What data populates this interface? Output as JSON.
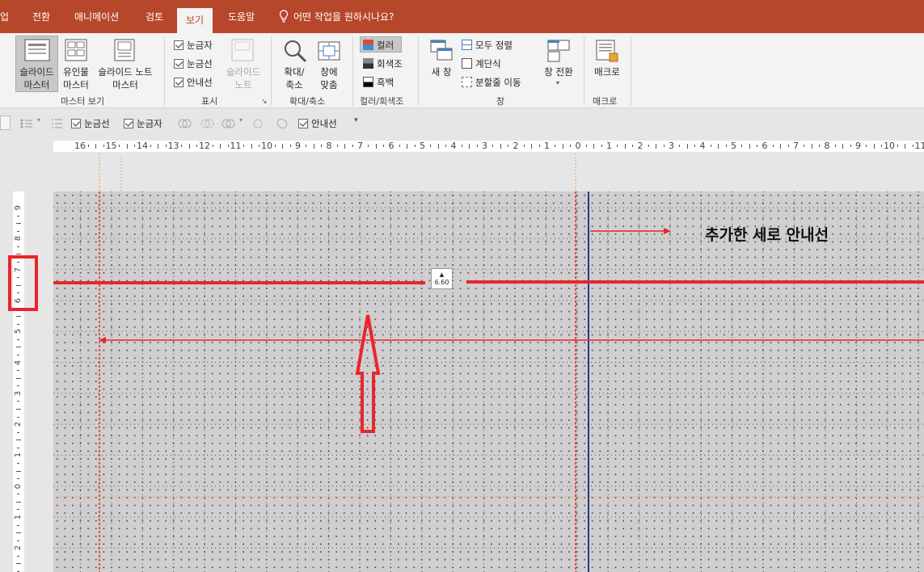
{
  "tabs": [
    {
      "label": "업",
      "active": false
    },
    {
      "label": "전환",
      "active": false
    },
    {
      "label": "애니메이션",
      "active": false
    },
    {
      "label": "검토",
      "active": false
    },
    {
      "label": "보기",
      "active": true
    },
    {
      "label": "도움말",
      "active": false
    }
  ],
  "tell_me": "어떤 작업을 원하시나요?",
  "ribbon": {
    "master_view": {
      "slide_master": [
        "슬라이드",
        "마스터"
      ],
      "handout_master": [
        "유인물",
        "마스터"
      ],
      "notes_master": [
        "슬라이드 노트",
        "마스터"
      ],
      "group": "마스터 보기"
    },
    "show": {
      "ruler": "눈금자",
      "gridlines": "눈금선",
      "guides": "안내선",
      "notes": [
        "슬라이드",
        "노트"
      ],
      "group": "표시"
    },
    "zoom": {
      "zoom": [
        "확대/",
        "축소"
      ],
      "fit_window": [
        "창에",
        "맞춤"
      ],
      "group": "확대/축소"
    },
    "color": {
      "color": "컬러",
      "grayscale": "회색조",
      "bw": "흑백",
      "group": "컬러/회색조"
    },
    "window": {
      "new_window": "새 창",
      "arrange_all": "모두 정렬",
      "cascade": "계단식",
      "move_split": "분할줄 이동",
      "switch_windows": "창 전환",
      "group": "창"
    },
    "macros": {
      "macro": "매크로",
      "group": "매크로"
    }
  },
  "qat": {
    "gridlines": "눈금선",
    "ruler": "눈금자",
    "guides": "안내선"
  },
  "hruler_labels": [
    "16",
    "15",
    "14",
    "13",
    "12",
    "11",
    "10",
    "9",
    "8",
    "7",
    "6",
    "5",
    "4",
    "3",
    "2",
    "1",
    "0",
    "1",
    "2",
    "3",
    "4",
    "5",
    "6",
    "7",
    "8",
    "9",
    "10",
    "11"
  ],
  "vruler_labels": [
    "9",
    "8",
    "7",
    "6",
    "5",
    "4",
    "3",
    "2",
    "1",
    "0",
    "1",
    "2"
  ],
  "canvas": {
    "annotation": "추가한 세로 안내선",
    "guide_tooltip": "6.60"
  },
  "colors": {
    "ribbon": "#b7472a",
    "guide": "#e8262b",
    "added_vertical_guide": "#1f3a93"
  }
}
